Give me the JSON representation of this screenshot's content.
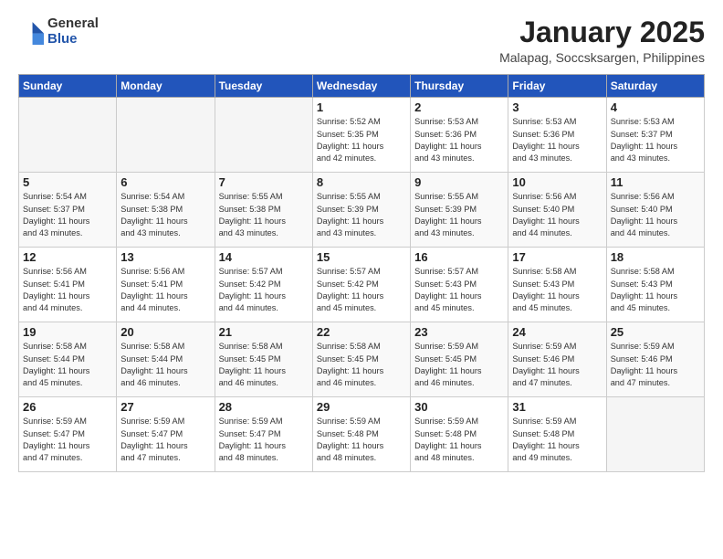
{
  "header": {
    "logo": {
      "general": "General",
      "blue": "Blue"
    },
    "title": "January 2025",
    "subtitle": "Malapag, Soccsksargen, Philippines"
  },
  "weekdays": [
    "Sunday",
    "Monday",
    "Tuesday",
    "Wednesday",
    "Thursday",
    "Friday",
    "Saturday"
  ],
  "weeks": [
    [
      {
        "day": "",
        "info": ""
      },
      {
        "day": "",
        "info": ""
      },
      {
        "day": "",
        "info": ""
      },
      {
        "day": "1",
        "info": "Sunrise: 5:52 AM\nSunset: 5:35 PM\nDaylight: 11 hours\nand 42 minutes."
      },
      {
        "day": "2",
        "info": "Sunrise: 5:53 AM\nSunset: 5:36 PM\nDaylight: 11 hours\nand 43 minutes."
      },
      {
        "day": "3",
        "info": "Sunrise: 5:53 AM\nSunset: 5:36 PM\nDaylight: 11 hours\nand 43 minutes."
      },
      {
        "day": "4",
        "info": "Sunrise: 5:53 AM\nSunset: 5:37 PM\nDaylight: 11 hours\nand 43 minutes."
      }
    ],
    [
      {
        "day": "5",
        "info": "Sunrise: 5:54 AM\nSunset: 5:37 PM\nDaylight: 11 hours\nand 43 minutes."
      },
      {
        "day": "6",
        "info": "Sunrise: 5:54 AM\nSunset: 5:38 PM\nDaylight: 11 hours\nand 43 minutes."
      },
      {
        "day": "7",
        "info": "Sunrise: 5:55 AM\nSunset: 5:38 PM\nDaylight: 11 hours\nand 43 minutes."
      },
      {
        "day": "8",
        "info": "Sunrise: 5:55 AM\nSunset: 5:39 PM\nDaylight: 11 hours\nand 43 minutes."
      },
      {
        "day": "9",
        "info": "Sunrise: 5:55 AM\nSunset: 5:39 PM\nDaylight: 11 hours\nand 43 minutes."
      },
      {
        "day": "10",
        "info": "Sunrise: 5:56 AM\nSunset: 5:40 PM\nDaylight: 11 hours\nand 44 minutes."
      },
      {
        "day": "11",
        "info": "Sunrise: 5:56 AM\nSunset: 5:40 PM\nDaylight: 11 hours\nand 44 minutes."
      }
    ],
    [
      {
        "day": "12",
        "info": "Sunrise: 5:56 AM\nSunset: 5:41 PM\nDaylight: 11 hours\nand 44 minutes."
      },
      {
        "day": "13",
        "info": "Sunrise: 5:56 AM\nSunset: 5:41 PM\nDaylight: 11 hours\nand 44 minutes."
      },
      {
        "day": "14",
        "info": "Sunrise: 5:57 AM\nSunset: 5:42 PM\nDaylight: 11 hours\nand 44 minutes."
      },
      {
        "day": "15",
        "info": "Sunrise: 5:57 AM\nSunset: 5:42 PM\nDaylight: 11 hours\nand 45 minutes."
      },
      {
        "day": "16",
        "info": "Sunrise: 5:57 AM\nSunset: 5:43 PM\nDaylight: 11 hours\nand 45 minutes."
      },
      {
        "day": "17",
        "info": "Sunrise: 5:58 AM\nSunset: 5:43 PM\nDaylight: 11 hours\nand 45 minutes."
      },
      {
        "day": "18",
        "info": "Sunrise: 5:58 AM\nSunset: 5:43 PM\nDaylight: 11 hours\nand 45 minutes."
      }
    ],
    [
      {
        "day": "19",
        "info": "Sunrise: 5:58 AM\nSunset: 5:44 PM\nDaylight: 11 hours\nand 45 minutes."
      },
      {
        "day": "20",
        "info": "Sunrise: 5:58 AM\nSunset: 5:44 PM\nDaylight: 11 hours\nand 46 minutes."
      },
      {
        "day": "21",
        "info": "Sunrise: 5:58 AM\nSunset: 5:45 PM\nDaylight: 11 hours\nand 46 minutes."
      },
      {
        "day": "22",
        "info": "Sunrise: 5:58 AM\nSunset: 5:45 PM\nDaylight: 11 hours\nand 46 minutes."
      },
      {
        "day": "23",
        "info": "Sunrise: 5:59 AM\nSunset: 5:45 PM\nDaylight: 11 hours\nand 46 minutes."
      },
      {
        "day": "24",
        "info": "Sunrise: 5:59 AM\nSunset: 5:46 PM\nDaylight: 11 hours\nand 47 minutes."
      },
      {
        "day": "25",
        "info": "Sunrise: 5:59 AM\nSunset: 5:46 PM\nDaylight: 11 hours\nand 47 minutes."
      }
    ],
    [
      {
        "day": "26",
        "info": "Sunrise: 5:59 AM\nSunset: 5:47 PM\nDaylight: 11 hours\nand 47 minutes."
      },
      {
        "day": "27",
        "info": "Sunrise: 5:59 AM\nSunset: 5:47 PM\nDaylight: 11 hours\nand 47 minutes."
      },
      {
        "day": "28",
        "info": "Sunrise: 5:59 AM\nSunset: 5:47 PM\nDaylight: 11 hours\nand 48 minutes."
      },
      {
        "day": "29",
        "info": "Sunrise: 5:59 AM\nSunset: 5:48 PM\nDaylight: 11 hours\nand 48 minutes."
      },
      {
        "day": "30",
        "info": "Sunrise: 5:59 AM\nSunset: 5:48 PM\nDaylight: 11 hours\nand 48 minutes."
      },
      {
        "day": "31",
        "info": "Sunrise: 5:59 AM\nSunset: 5:48 PM\nDaylight: 11 hours\nand 49 minutes."
      },
      {
        "day": "",
        "info": ""
      }
    ]
  ]
}
